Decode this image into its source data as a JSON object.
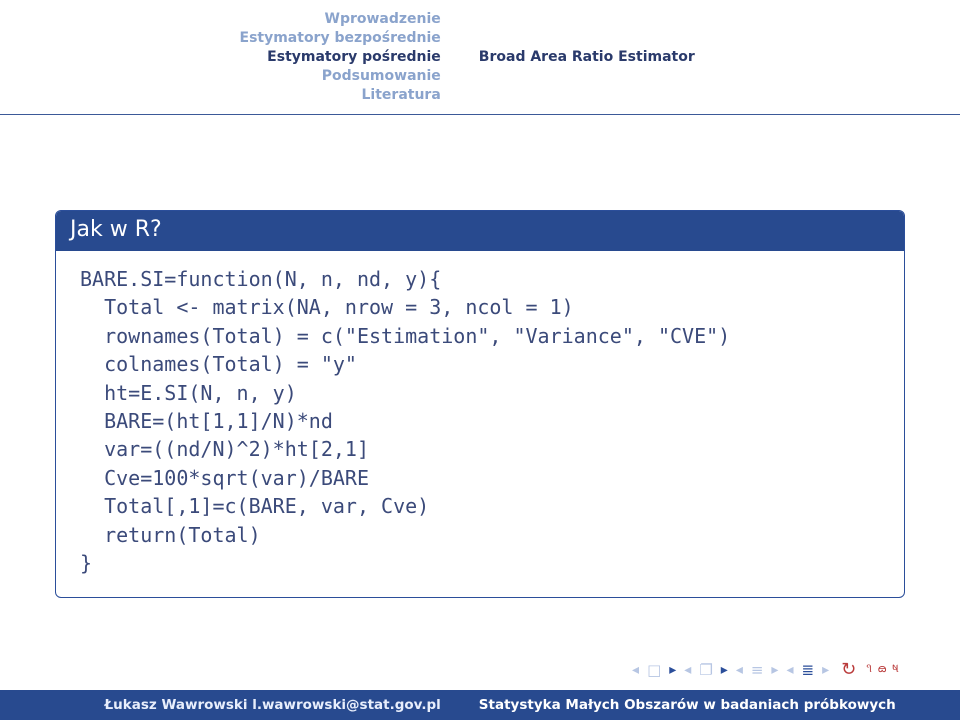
{
  "header": {
    "nav": [
      {
        "label": "Wprowadzenie",
        "active": false
      },
      {
        "label": "Estymatory bezpośrednie",
        "active": false
      },
      {
        "label": "Estymatory pośrednie",
        "active": true
      },
      {
        "label": "Podsumowanie",
        "active": false
      },
      {
        "label": "Literatura",
        "active": false
      }
    ],
    "subsection": "Broad Area Ratio Estimator"
  },
  "block": {
    "title": "Jak w R?",
    "code": "BARE.SI=function(N, n, nd, y){\n  Total <- matrix(NA, nrow = 3, ncol = 1)\n  rownames(Total) = c(\"Estimation\", \"Variance\", \"CVE\")\n  colnames(Total) = \"y\"\n  ht=E.SI(N, n, y)\n  BARE=(ht[1,1]/N)*nd\n  var=((nd/N)^2)*ht[2,1]\n  Cve=100*sqrt(var)/BARE\n  Total[,1]=c(BARE, var, Cve)\n  return(Total)\n}"
  },
  "footer": {
    "author": "Łukasz Wawrowski l.wawrowski@stat.gov.pl",
    "title": "Statystyka Małych Obszarów w badaniach próbkowych"
  }
}
